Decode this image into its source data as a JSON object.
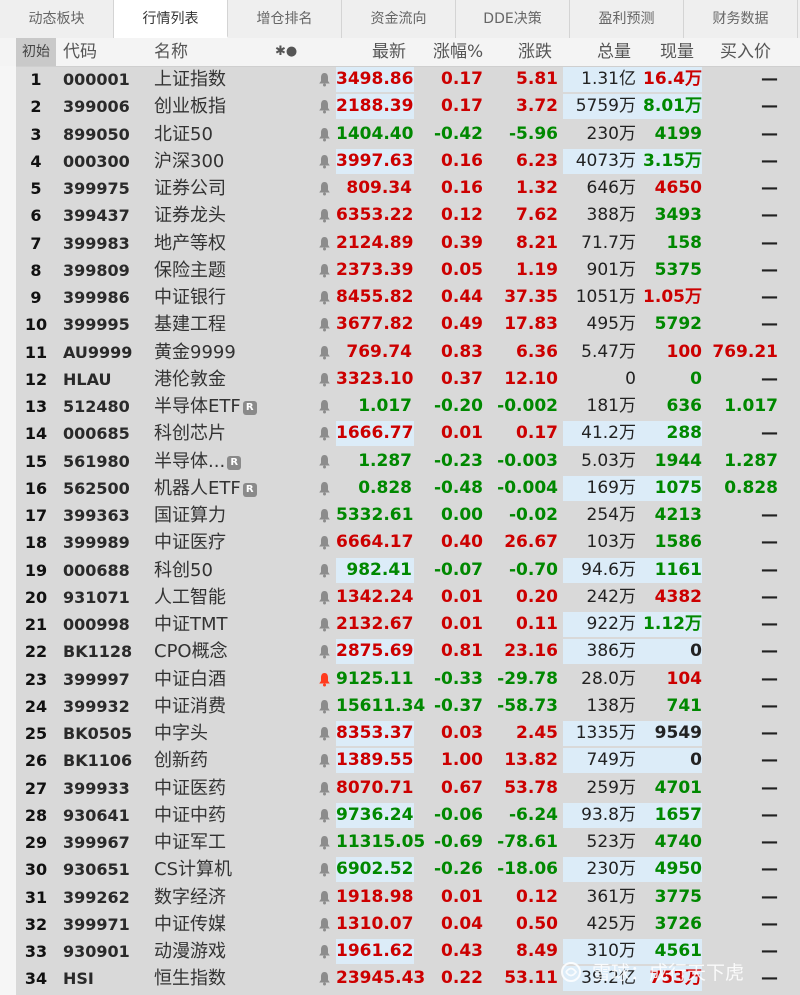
{
  "tabs": [
    "动态板块",
    "行情列表",
    "增仓排名",
    "资金流向",
    "DDE决策",
    "盈利预测",
    "财务数据"
  ],
  "active_tab": 1,
  "header": {
    "rownum": "初始",
    "code": "代码",
    "name": "名称",
    "flags": "✱●",
    "latest": "最新",
    "pct": "涨幅%",
    "chg": "涨跌",
    "vol": "总量",
    "cur": "现量",
    "bid": "买入价"
  },
  "rows": [
    {
      "num": "1",
      "code": "000001",
      "name": "上证指数",
      "latest": "3498.86",
      "pct": "0.17",
      "chg": "5.81",
      "vol": "1.31亿",
      "cur": "16.4万",
      "bid": "—",
      "dir": "up",
      "curdir": "up",
      "hl_latest": true,
      "hl_vol": true
    },
    {
      "num": "2",
      "code": "399006",
      "name": "创业板指",
      "latest": "2188.39",
      "pct": "0.17",
      "chg": "3.72",
      "vol": "5759万",
      "cur": "8.01万",
      "bid": "—",
      "dir": "up",
      "curdir": "down",
      "hl_latest": true,
      "hl_vol": true
    },
    {
      "num": "3",
      "code": "899050",
      "name": "北证50",
      "latest": "1404.40",
      "pct": "-0.42",
      "chg": "-5.96",
      "vol": "230万",
      "cur": "4199",
      "bid": "—",
      "dir": "down",
      "curdir": "down"
    },
    {
      "num": "4",
      "code": "000300",
      "name": "沪深300",
      "latest": "3997.63",
      "pct": "0.16",
      "chg": "6.23",
      "vol": "4073万",
      "cur": "3.15万",
      "bid": "—",
      "dir": "up",
      "curdir": "down",
      "hl_latest": true,
      "hl_vol": true
    },
    {
      "num": "5",
      "code": "399975",
      "name": "证券公司",
      "latest": "809.34",
      "pct": "0.16",
      "chg": "1.32",
      "vol": "646万",
      "cur": "4650",
      "bid": "—",
      "dir": "up",
      "curdir": "up"
    },
    {
      "num": "6",
      "code": "399437",
      "name": "证券龙头",
      "latest": "6353.22",
      "pct": "0.12",
      "chg": "7.62",
      "vol": "388万",
      "cur": "3493",
      "bid": "—",
      "dir": "up",
      "curdir": "down"
    },
    {
      "num": "7",
      "code": "399983",
      "name": "地产等权",
      "latest": "2124.89",
      "pct": "0.39",
      "chg": "8.21",
      "vol": "71.7万",
      "cur": "158",
      "bid": "—",
      "dir": "up",
      "curdir": "down"
    },
    {
      "num": "8",
      "code": "399809",
      "name": "保险主题",
      "latest": "2373.39",
      "pct": "0.05",
      "chg": "1.19",
      "vol": "901万",
      "cur": "5375",
      "bid": "—",
      "dir": "up",
      "curdir": "down"
    },
    {
      "num": "9",
      "code": "399986",
      "name": "中证银行",
      "latest": "8455.82",
      "pct": "0.44",
      "chg": "37.35",
      "vol": "1051万",
      "cur": "1.05万",
      "bid": "—",
      "dir": "up",
      "curdir": "up"
    },
    {
      "num": "10",
      "code": "399995",
      "name": "基建工程",
      "latest": "3677.82",
      "pct": "0.49",
      "chg": "17.83",
      "vol": "495万",
      "cur": "5792",
      "bid": "—",
      "dir": "up",
      "curdir": "down"
    },
    {
      "num": "11",
      "code": "AU9999",
      "name": "黄金9999",
      "latest": "769.74",
      "pct": "0.83",
      "chg": "6.36",
      "vol": "5.47万",
      "cur": "100",
      "bid": "769.21",
      "dir": "up",
      "curdir": "up",
      "biddir": "up"
    },
    {
      "num": "12",
      "code": "HLAU",
      "name": "港伦敦金",
      "latest": "3323.10",
      "pct": "0.37",
      "chg": "12.10",
      "vol": "0",
      "cur": "0",
      "bid": "—",
      "dir": "up",
      "curdir": "down"
    },
    {
      "num": "13",
      "code": "512480",
      "name": "半导体ETF",
      "badge": "R",
      "latest": "1.017",
      "pct": "-0.20",
      "chg": "-0.002",
      "vol": "181万",
      "cur": "636",
      "bid": "1.017",
      "dir": "down",
      "curdir": "down",
      "biddir": "down"
    },
    {
      "num": "14",
      "code": "000685",
      "name": "科创芯片",
      "latest": "1666.77",
      "pct": "0.01",
      "chg": "0.17",
      "vol": "41.2万",
      "cur": "288",
      "bid": "—",
      "dir": "up",
      "curdir": "down",
      "hl_latest": true,
      "hl_vol": true
    },
    {
      "num": "15",
      "code": "561980",
      "name": "半导体...",
      "badge": "R",
      "latest": "1.287",
      "pct": "-0.23",
      "chg": "-0.003",
      "vol": "5.03万",
      "cur": "1944",
      "bid": "1.287",
      "dir": "down",
      "curdir": "down",
      "biddir": "down"
    },
    {
      "num": "16",
      "code": "562500",
      "name": "机器人ETF",
      "badge": "R",
      "latest": "0.828",
      "pct": "-0.48",
      "chg": "-0.004",
      "vol": "169万",
      "cur": "1075",
      "bid": "0.828",
      "dir": "down",
      "curdir": "down",
      "biddir": "down",
      "hl_vol": true
    },
    {
      "num": "17",
      "code": "399363",
      "name": "国证算力",
      "latest": "5332.61",
      "pct": "0.00",
      "chg": "-0.02",
      "vol": "254万",
      "cur": "4213",
      "bid": "—",
      "dir": "down",
      "pctdir": "down",
      "curdir": "down"
    },
    {
      "num": "18",
      "code": "399989",
      "name": "中证医疗",
      "latest": "6664.17",
      "pct": "0.40",
      "chg": "26.67",
      "vol": "103万",
      "cur": "1586",
      "bid": "—",
      "dir": "up",
      "curdir": "down"
    },
    {
      "num": "19",
      "code": "000688",
      "name": "科创50",
      "latest": "982.41",
      "pct": "-0.07",
      "chg": "-0.70",
      "vol": "94.6万",
      "cur": "1161",
      "bid": "—",
      "dir": "down",
      "curdir": "down",
      "hl_latest": true,
      "hl_vol": true
    },
    {
      "num": "20",
      "code": "931071",
      "name": "人工智能",
      "latest": "1342.24",
      "pct": "0.01",
      "chg": "0.20",
      "vol": "242万",
      "cur": "4382",
      "bid": "—",
      "dir": "up",
      "curdir": "up"
    },
    {
      "num": "21",
      "code": "000998",
      "name": "中证TMT",
      "latest": "2132.67",
      "pct": "0.01",
      "chg": "0.11",
      "vol": "922万",
      "cur": "1.12万",
      "bid": "—",
      "dir": "up",
      "curdir": "down",
      "hl_vol": true
    },
    {
      "num": "22",
      "code": "BK1128",
      "name": "CPO概念",
      "latest": "2875.69",
      "pct": "0.81",
      "chg": "23.16",
      "vol": "386万",
      "cur": "0",
      "bid": "—",
      "dir": "up",
      "curdir": "flat",
      "hl_latest": true,
      "hl_vol": true
    },
    {
      "num": "23",
      "code": "399997",
      "name": "中证白酒",
      "latest": "9125.11",
      "pct": "-0.33",
      "chg": "-29.78",
      "vol": "28.0万",
      "cur": "104",
      "bid": "—",
      "dir": "down",
      "curdir": "up",
      "bell_active": true
    },
    {
      "num": "24",
      "code": "399932",
      "name": "中证消费",
      "latest": "15611.34",
      "pct": "-0.37",
      "chg": "-58.73",
      "vol": "138万",
      "cur": "741",
      "bid": "—",
      "dir": "down",
      "curdir": "down"
    },
    {
      "num": "25",
      "code": "BK0505",
      "name": "中字头",
      "latest": "8353.37",
      "pct": "0.03",
      "chg": "2.45",
      "vol": "1335万",
      "cur": "9549",
      "bid": "—",
      "dir": "up",
      "curdir": "flat",
      "hl_latest": true,
      "hl_vol": true
    },
    {
      "num": "26",
      "code": "BK1106",
      "name": "创新药",
      "latest": "1389.55",
      "pct": "1.00",
      "chg": "13.82",
      "vol": "749万",
      "cur": "0",
      "bid": "—",
      "dir": "up",
      "curdir": "flat",
      "hl_latest": true,
      "hl_vol": true
    },
    {
      "num": "27",
      "code": "399933",
      "name": "中证医药",
      "latest": "8070.71",
      "pct": "0.67",
      "chg": "53.78",
      "vol": "259万",
      "cur": "4701",
      "bid": "—",
      "dir": "up",
      "curdir": "down"
    },
    {
      "num": "28",
      "code": "930641",
      "name": "中证中药",
      "latest": "9736.24",
      "pct": "-0.06",
      "chg": "-6.24",
      "vol": "93.8万",
      "cur": "1657",
      "bid": "—",
      "dir": "down",
      "curdir": "down",
      "hl_latest": true,
      "hl_vol": true
    },
    {
      "num": "29",
      "code": "399967",
      "name": "中证军工",
      "latest": "11315.05",
      "pct": "-0.69",
      "chg": "-78.61",
      "vol": "523万",
      "cur": "4740",
      "bid": "—",
      "dir": "down",
      "curdir": "down"
    },
    {
      "num": "30",
      "code": "930651",
      "name": "CS计算机",
      "latest": "6902.52",
      "pct": "-0.26",
      "chg": "-18.06",
      "vol": "230万",
      "cur": "4950",
      "bid": "—",
      "dir": "down",
      "curdir": "down",
      "hl_latest": true,
      "hl_vol": true
    },
    {
      "num": "31",
      "code": "399262",
      "name": "数字经济",
      "latest": "1918.98",
      "pct": "0.01",
      "chg": "0.12",
      "vol": "361万",
      "cur": "3775",
      "bid": "—",
      "dir": "up",
      "curdir": "down"
    },
    {
      "num": "32",
      "code": "399971",
      "name": "中证传媒",
      "latest": "1310.07",
      "pct": "0.04",
      "chg": "0.50",
      "vol": "425万",
      "cur": "3726",
      "bid": "—",
      "dir": "up",
      "curdir": "down"
    },
    {
      "num": "33",
      "code": "930901",
      "name": "动漫游戏",
      "latest": "1961.62",
      "pct": "0.43",
      "chg": "8.49",
      "vol": "310万",
      "cur": "4561",
      "bid": "—",
      "dir": "up",
      "curdir": "down",
      "hl_latest": true,
      "hl_vol": true
    },
    {
      "num": "34",
      "code": "HSI",
      "name": "恒生指数",
      "latest": "23945.43",
      "pct": "0.22",
      "chg": "53.11",
      "vol": "39.2亿",
      "cur": "753万",
      "bid": "—",
      "dir": "up",
      "curdir": "up",
      "hl_vol": true
    }
  ],
  "watermark": "雪球：成行天下虎",
  "colors": {
    "up": "#cc0000",
    "down": "#008800",
    "highlight": "#dcecf8"
  }
}
